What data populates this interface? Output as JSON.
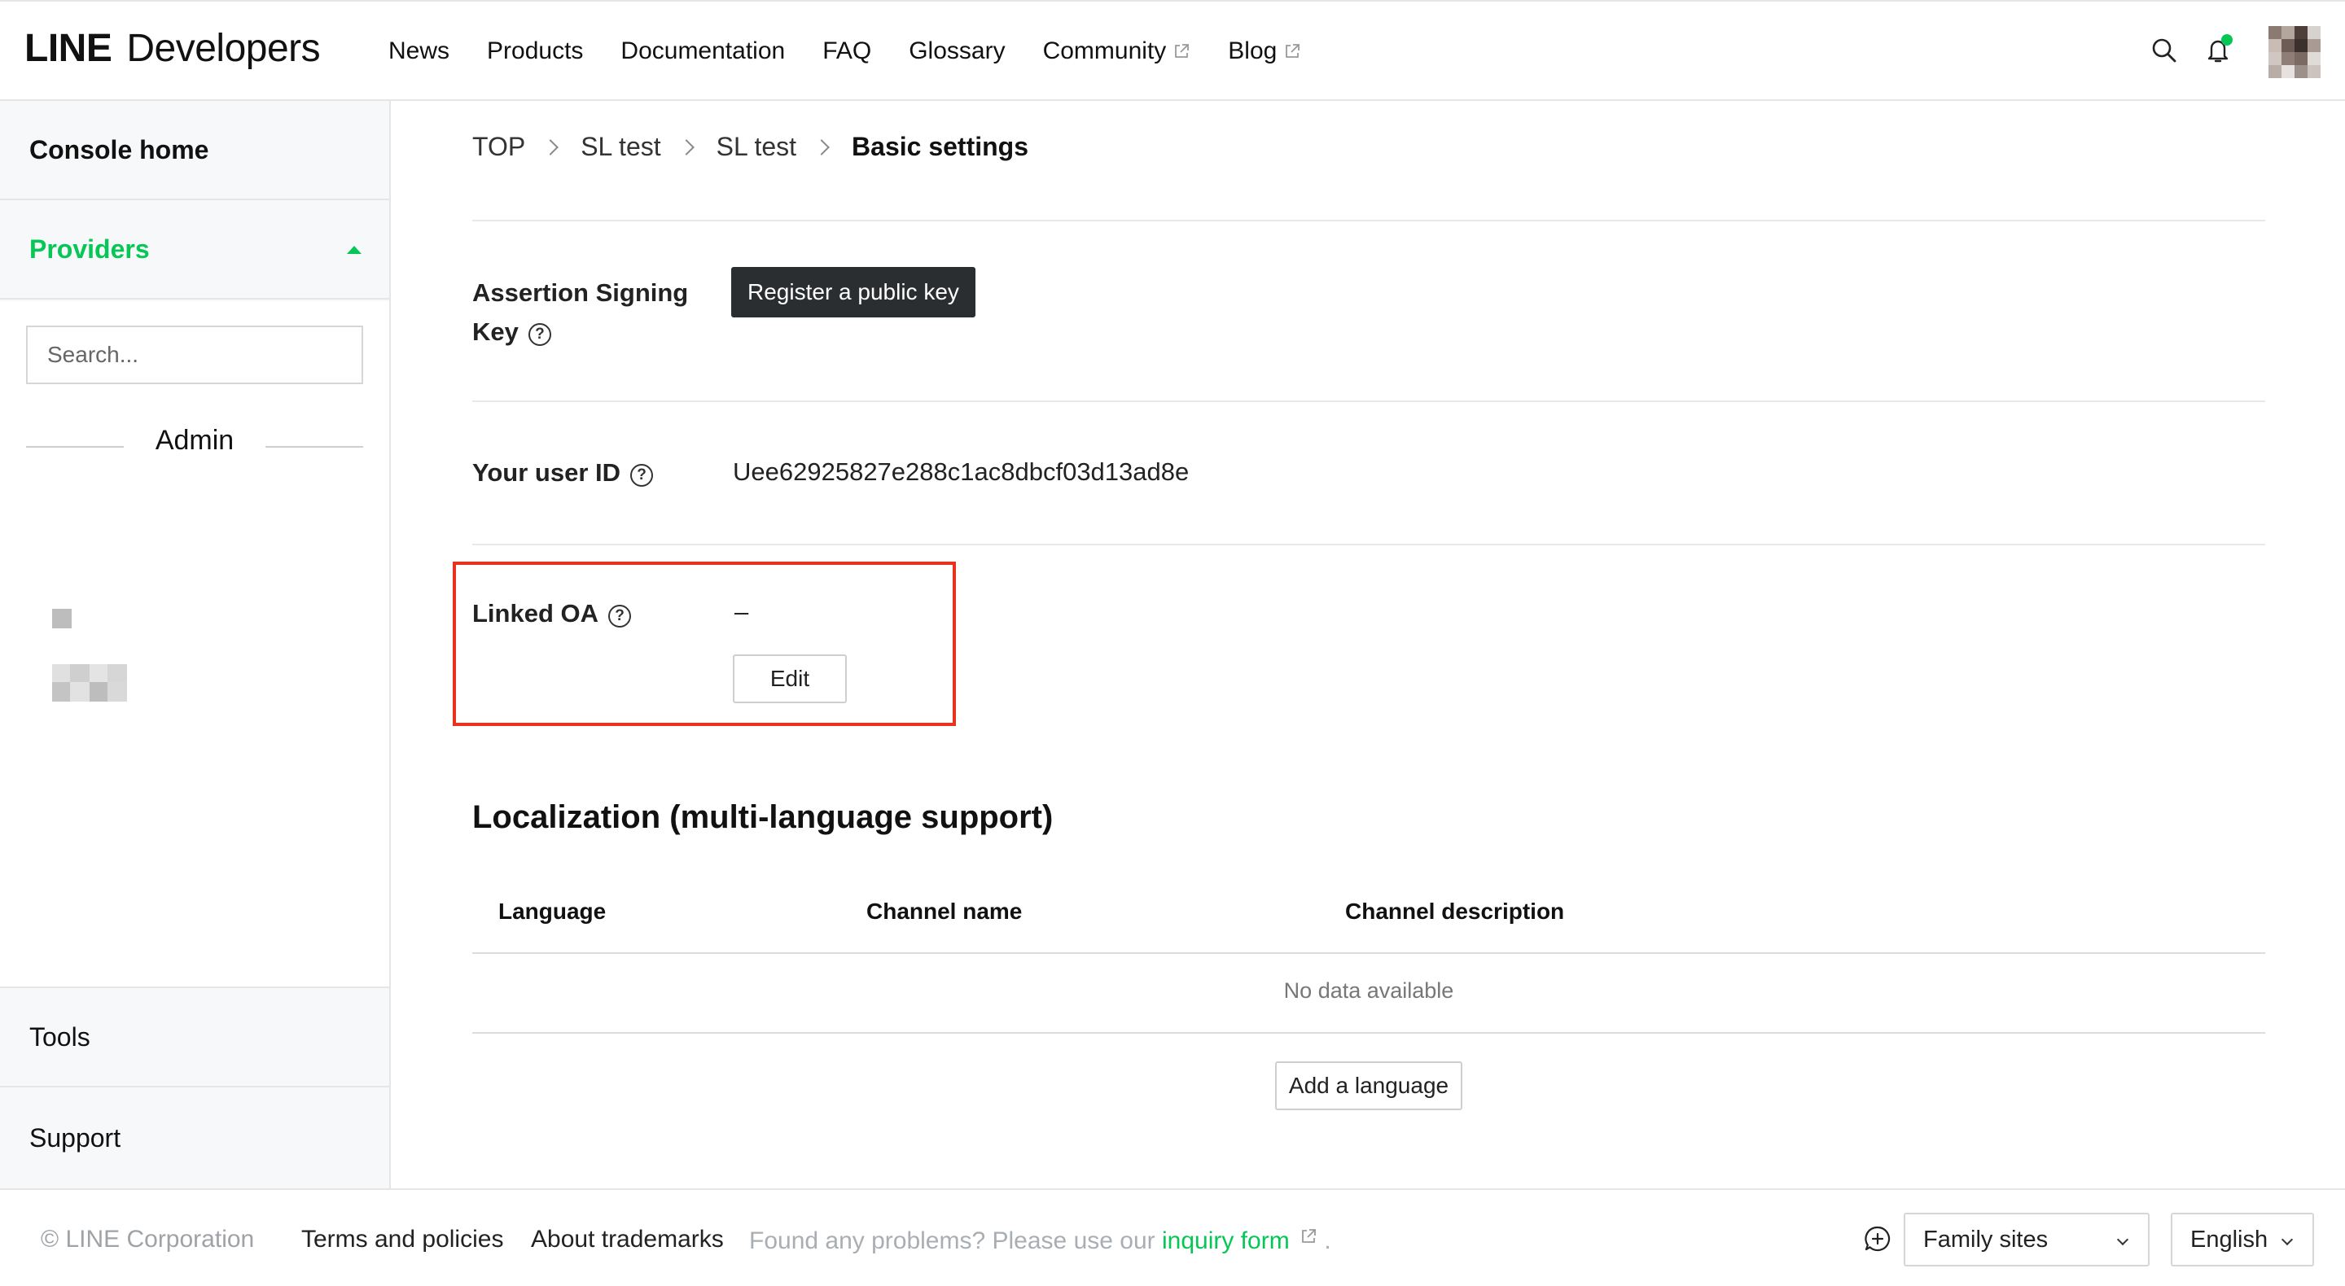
{
  "header": {
    "logo_line": "LINE",
    "logo_dev": "Developers",
    "nav": [
      {
        "label": "News",
        "external": false
      },
      {
        "label": "Products",
        "external": false
      },
      {
        "label": "Documentation",
        "external": false
      },
      {
        "label": "FAQ",
        "external": false
      },
      {
        "label": "Glossary",
        "external": false
      },
      {
        "label": "Community",
        "external": true
      },
      {
        "label": "Blog",
        "external": true
      }
    ],
    "icons": [
      "search-icon",
      "bell-icon",
      "avatar"
    ],
    "notification_dot_color": "#06c755"
  },
  "sidebar": {
    "console_home": "Console home",
    "providers": "Providers",
    "search_placeholder": "Search...",
    "admin_label": "Admin",
    "tools": "Tools",
    "support": "Support",
    "accent_color": "#06c755"
  },
  "breadcrumb": [
    "TOP",
    "SL test",
    "SL test",
    "Basic settings"
  ],
  "settings": {
    "assertion_label_line1": "Assertion Signing",
    "assertion_label_line2": "Key",
    "register_button": "Register a public key",
    "user_id_label": "Your user ID",
    "user_id_value": "Uee62925827e288c1ac8dbcf03d13ad8e",
    "linked_oa_label": "Linked OA",
    "linked_oa_value": "–",
    "edit_button": "Edit",
    "highlight_color": "#e8321e"
  },
  "localization": {
    "title": "Localization (multi-language support)",
    "columns": [
      "Language",
      "Channel name",
      "Channel description"
    ],
    "empty_text": "No data available",
    "add_button": "Add a language"
  },
  "footer": {
    "copyright": "© LINE Corporation",
    "terms": "Terms and policies",
    "trademarks": "About trademarks",
    "problem_text": "Found any problems? Please use our ",
    "inquiry_link": "inquiry form",
    "period": ".",
    "family_sites": "Family sites",
    "language": "English"
  }
}
